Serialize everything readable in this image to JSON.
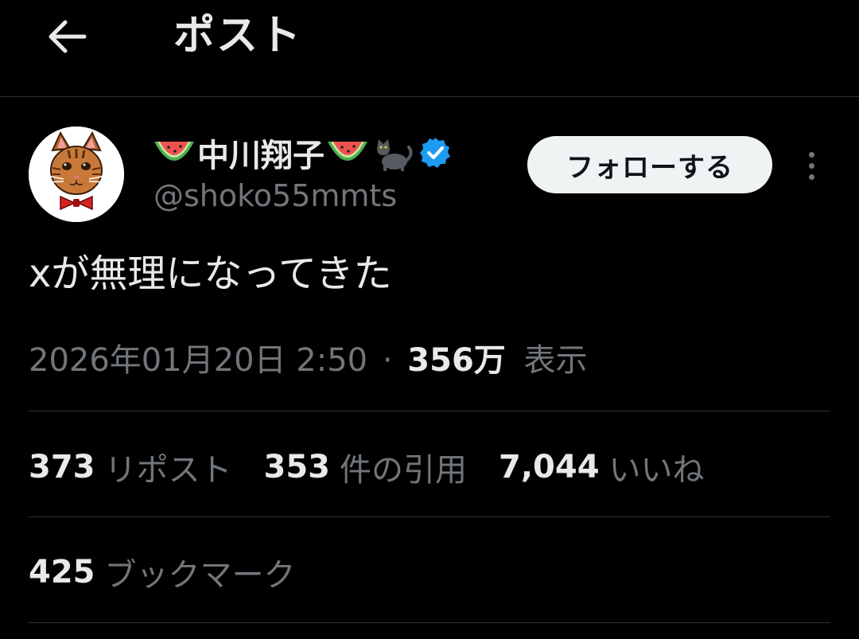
{
  "header": {
    "title": "ポスト",
    "back_icon": "arrow-left-icon"
  },
  "author": {
    "name": "中川翔子",
    "name_emojis": [
      "watermelon",
      "watermelon",
      "black-cat"
    ],
    "verified": true,
    "verified_color": "#1d9bf0",
    "handle": "@shoko55mmts",
    "follow_label": "フォローする",
    "more_icon": "more-vertical-icon"
  },
  "tweet": {
    "text": "xが無理になってきた",
    "date": "2026年01月20日 2:50",
    "separator": "·",
    "views_count": "356万",
    "views_label": "表示"
  },
  "stats": {
    "reposts_count": "373",
    "reposts_label": "リポスト",
    "quotes_count": "353",
    "quotes_label": "件の引用",
    "likes_count": "7,044",
    "likes_label": "いいね",
    "bookmarks_count": "425",
    "bookmarks_label": "ブックマーク"
  },
  "colors": {
    "background": "#000000",
    "primary_text": "#e7e9ea",
    "secondary_text": "#71767b",
    "divider": "#2f3336",
    "follow_bg": "#eff3f4"
  }
}
